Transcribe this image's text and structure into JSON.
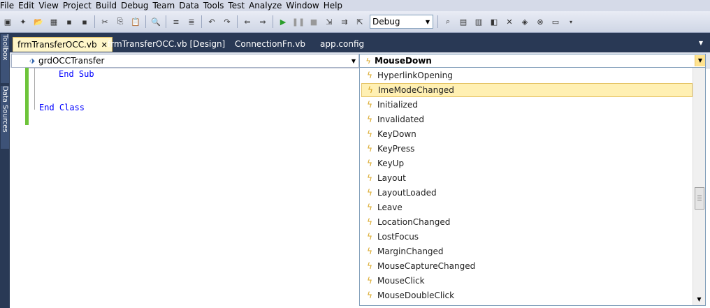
{
  "menu": [
    "File",
    "Edit",
    "View",
    "Project",
    "Build",
    "Debug",
    "Team",
    "Data",
    "Tools",
    "Test",
    "Analyze",
    "Window",
    "Help"
  ],
  "toolbar": {
    "config_value": "Debug",
    "icons": [
      "new-project-icon",
      "add-item-icon",
      "open-file-icon",
      "add-new-item-icon",
      "save-icon",
      "save-all-icon",
      "cut-icon",
      "copy-icon",
      "paste-icon",
      "find-icon",
      "comment-icon",
      "uncomment-icon",
      "undo-icon",
      "redo-icon",
      "navigate-backward-icon",
      "navigate-forward-icon",
      "start-debugging-icon",
      "pause-icon",
      "stop-icon",
      "step-into-icon",
      "step-over-icon",
      "step-out-icon"
    ]
  },
  "side_tabs": [
    "Toolbox",
    "Data Sources"
  ],
  "tabs": [
    {
      "label": "frmTransferOCC.vb",
      "active": true
    },
    {
      "label": "frmTransferOCC.vb [Design]",
      "active": false
    },
    {
      "label": "ConnectionFn.vb",
      "active": false
    },
    {
      "label": "app.config",
      "active": false
    }
  ],
  "editor": {
    "class_combo": "grdOCCTransfer",
    "event_combo": "MouseDown",
    "code_lines": [
      "End Sub",
      "End Class"
    ]
  },
  "dropdown": {
    "selected": "ImeModeChanged",
    "items": [
      "HyperlinkOpening",
      "ImeModeChanged",
      "Initialized",
      "Invalidated",
      "KeyDown",
      "KeyPress",
      "KeyUp",
      "Layout",
      "LayoutLoaded",
      "Leave",
      "LocationChanged",
      "LostFocus",
      "MarginChanged",
      "MouseCaptureChanged",
      "MouseClick",
      "MouseDoubleClick"
    ]
  },
  "colors": {
    "chrome": "#293955",
    "event_icon": "#d9a520",
    "selection": "#fff0b3",
    "change_bar": "#6ec43a"
  }
}
